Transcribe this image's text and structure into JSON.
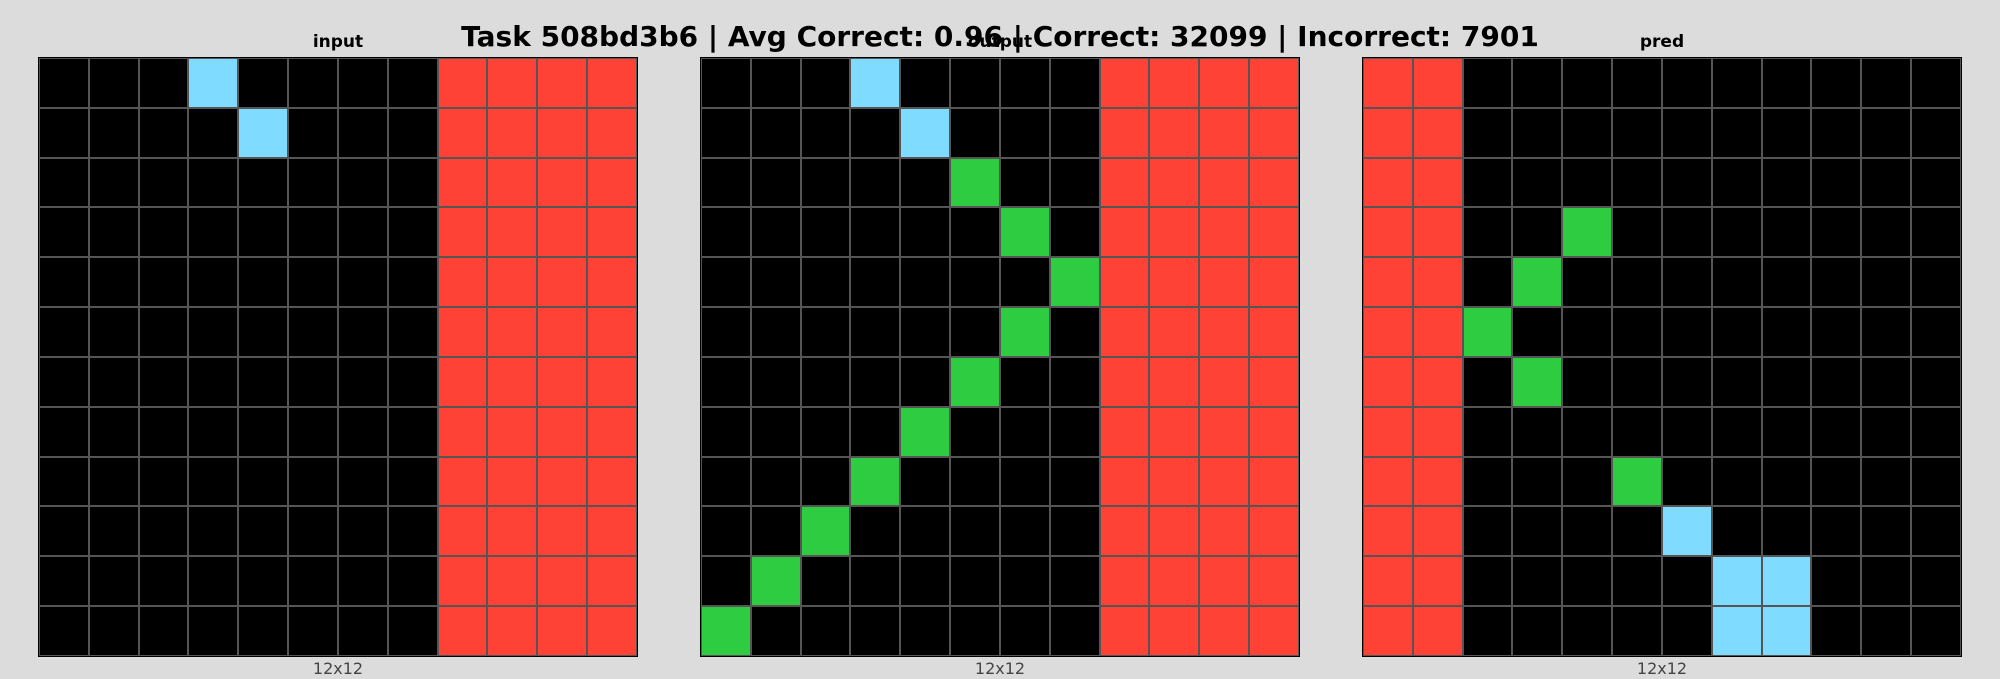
{
  "title": "Task 508bd3b6 | Avg Correct: 0.96 | Correct: 32099 | Incorrect: 7901",
  "palette": {
    "0": "#000000",
    "2": "#ff4136",
    "3": "#2ecc40",
    "8": "#7fdbff"
  },
  "panels": [
    {
      "title": "input",
      "size_label": "12x12",
      "grid": [
        [
          0,
          0,
          0,
          8,
          0,
          0,
          0,
          0,
          2,
          2,
          2,
          2
        ],
        [
          0,
          0,
          0,
          0,
          8,
          0,
          0,
          0,
          2,
          2,
          2,
          2
        ],
        [
          0,
          0,
          0,
          0,
          0,
          0,
          0,
          0,
          2,
          2,
          2,
          2
        ],
        [
          0,
          0,
          0,
          0,
          0,
          0,
          0,
          0,
          2,
          2,
          2,
          2
        ],
        [
          0,
          0,
          0,
          0,
          0,
          0,
          0,
          0,
          2,
          2,
          2,
          2
        ],
        [
          0,
          0,
          0,
          0,
          0,
          0,
          0,
          0,
          2,
          2,
          2,
          2
        ],
        [
          0,
          0,
          0,
          0,
          0,
          0,
          0,
          0,
          2,
          2,
          2,
          2
        ],
        [
          0,
          0,
          0,
          0,
          0,
          0,
          0,
          0,
          2,
          2,
          2,
          2
        ],
        [
          0,
          0,
          0,
          0,
          0,
          0,
          0,
          0,
          2,
          2,
          2,
          2
        ],
        [
          0,
          0,
          0,
          0,
          0,
          0,
          0,
          0,
          2,
          2,
          2,
          2
        ],
        [
          0,
          0,
          0,
          0,
          0,
          0,
          0,
          0,
          2,
          2,
          2,
          2
        ],
        [
          0,
          0,
          0,
          0,
          0,
          0,
          0,
          0,
          2,
          2,
          2,
          2
        ]
      ]
    },
    {
      "title": "output",
      "size_label": "12x12",
      "grid": [
        [
          0,
          0,
          0,
          8,
          0,
          0,
          0,
          0,
          2,
          2,
          2,
          2
        ],
        [
          0,
          0,
          0,
          0,
          8,
          0,
          0,
          0,
          2,
          2,
          2,
          2
        ],
        [
          0,
          0,
          0,
          0,
          0,
          3,
          0,
          0,
          2,
          2,
          2,
          2
        ],
        [
          0,
          0,
          0,
          0,
          0,
          0,
          3,
          0,
          2,
          2,
          2,
          2
        ],
        [
          0,
          0,
          0,
          0,
          0,
          0,
          0,
          3,
          2,
          2,
          2,
          2
        ],
        [
          0,
          0,
          0,
          0,
          0,
          0,
          3,
          0,
          2,
          2,
          2,
          2
        ],
        [
          0,
          0,
          0,
          0,
          0,
          3,
          0,
          0,
          2,
          2,
          2,
          2
        ],
        [
          0,
          0,
          0,
          0,
          3,
          0,
          0,
          0,
          2,
          2,
          2,
          2
        ],
        [
          0,
          0,
          0,
          3,
          0,
          0,
          0,
          0,
          2,
          2,
          2,
          2
        ],
        [
          0,
          0,
          3,
          0,
          0,
          0,
          0,
          0,
          2,
          2,
          2,
          2
        ],
        [
          0,
          3,
          0,
          0,
          0,
          0,
          0,
          0,
          2,
          2,
          2,
          2
        ],
        [
          3,
          0,
          0,
          0,
          0,
          0,
          0,
          0,
          2,
          2,
          2,
          2
        ]
      ]
    },
    {
      "title": "pred",
      "size_label": "12x12",
      "grid": [
        [
          2,
          2,
          0,
          0,
          0,
          0,
          0,
          0,
          0,
          0,
          0,
          0
        ],
        [
          2,
          2,
          0,
          0,
          0,
          0,
          0,
          0,
          0,
          0,
          0,
          0
        ],
        [
          2,
          2,
          0,
          0,
          0,
          0,
          0,
          0,
          0,
          0,
          0,
          0
        ],
        [
          2,
          2,
          0,
          0,
          3,
          0,
          0,
          0,
          0,
          0,
          0,
          0
        ],
        [
          2,
          2,
          0,
          3,
          0,
          0,
          0,
          0,
          0,
          0,
          0,
          0
        ],
        [
          2,
          2,
          3,
          0,
          0,
          0,
          0,
          0,
          0,
          0,
          0,
          0
        ],
        [
          2,
          2,
          0,
          3,
          0,
          0,
          0,
          0,
          0,
          0,
          0,
          0
        ],
        [
          2,
          2,
          0,
          0,
          0,
          0,
          0,
          0,
          0,
          0,
          0,
          0
        ],
        [
          2,
          2,
          0,
          0,
          0,
          3,
          0,
          0,
          0,
          0,
          0,
          0
        ],
        [
          2,
          2,
          0,
          0,
          0,
          0,
          8,
          0,
          0,
          0,
          0,
          0
        ],
        [
          2,
          2,
          0,
          0,
          0,
          0,
          0,
          8,
          8,
          0,
          0,
          0
        ],
        [
          2,
          2,
          0,
          0,
          0,
          0,
          0,
          8,
          8,
          0,
          0,
          0
        ]
      ]
    }
  ]
}
